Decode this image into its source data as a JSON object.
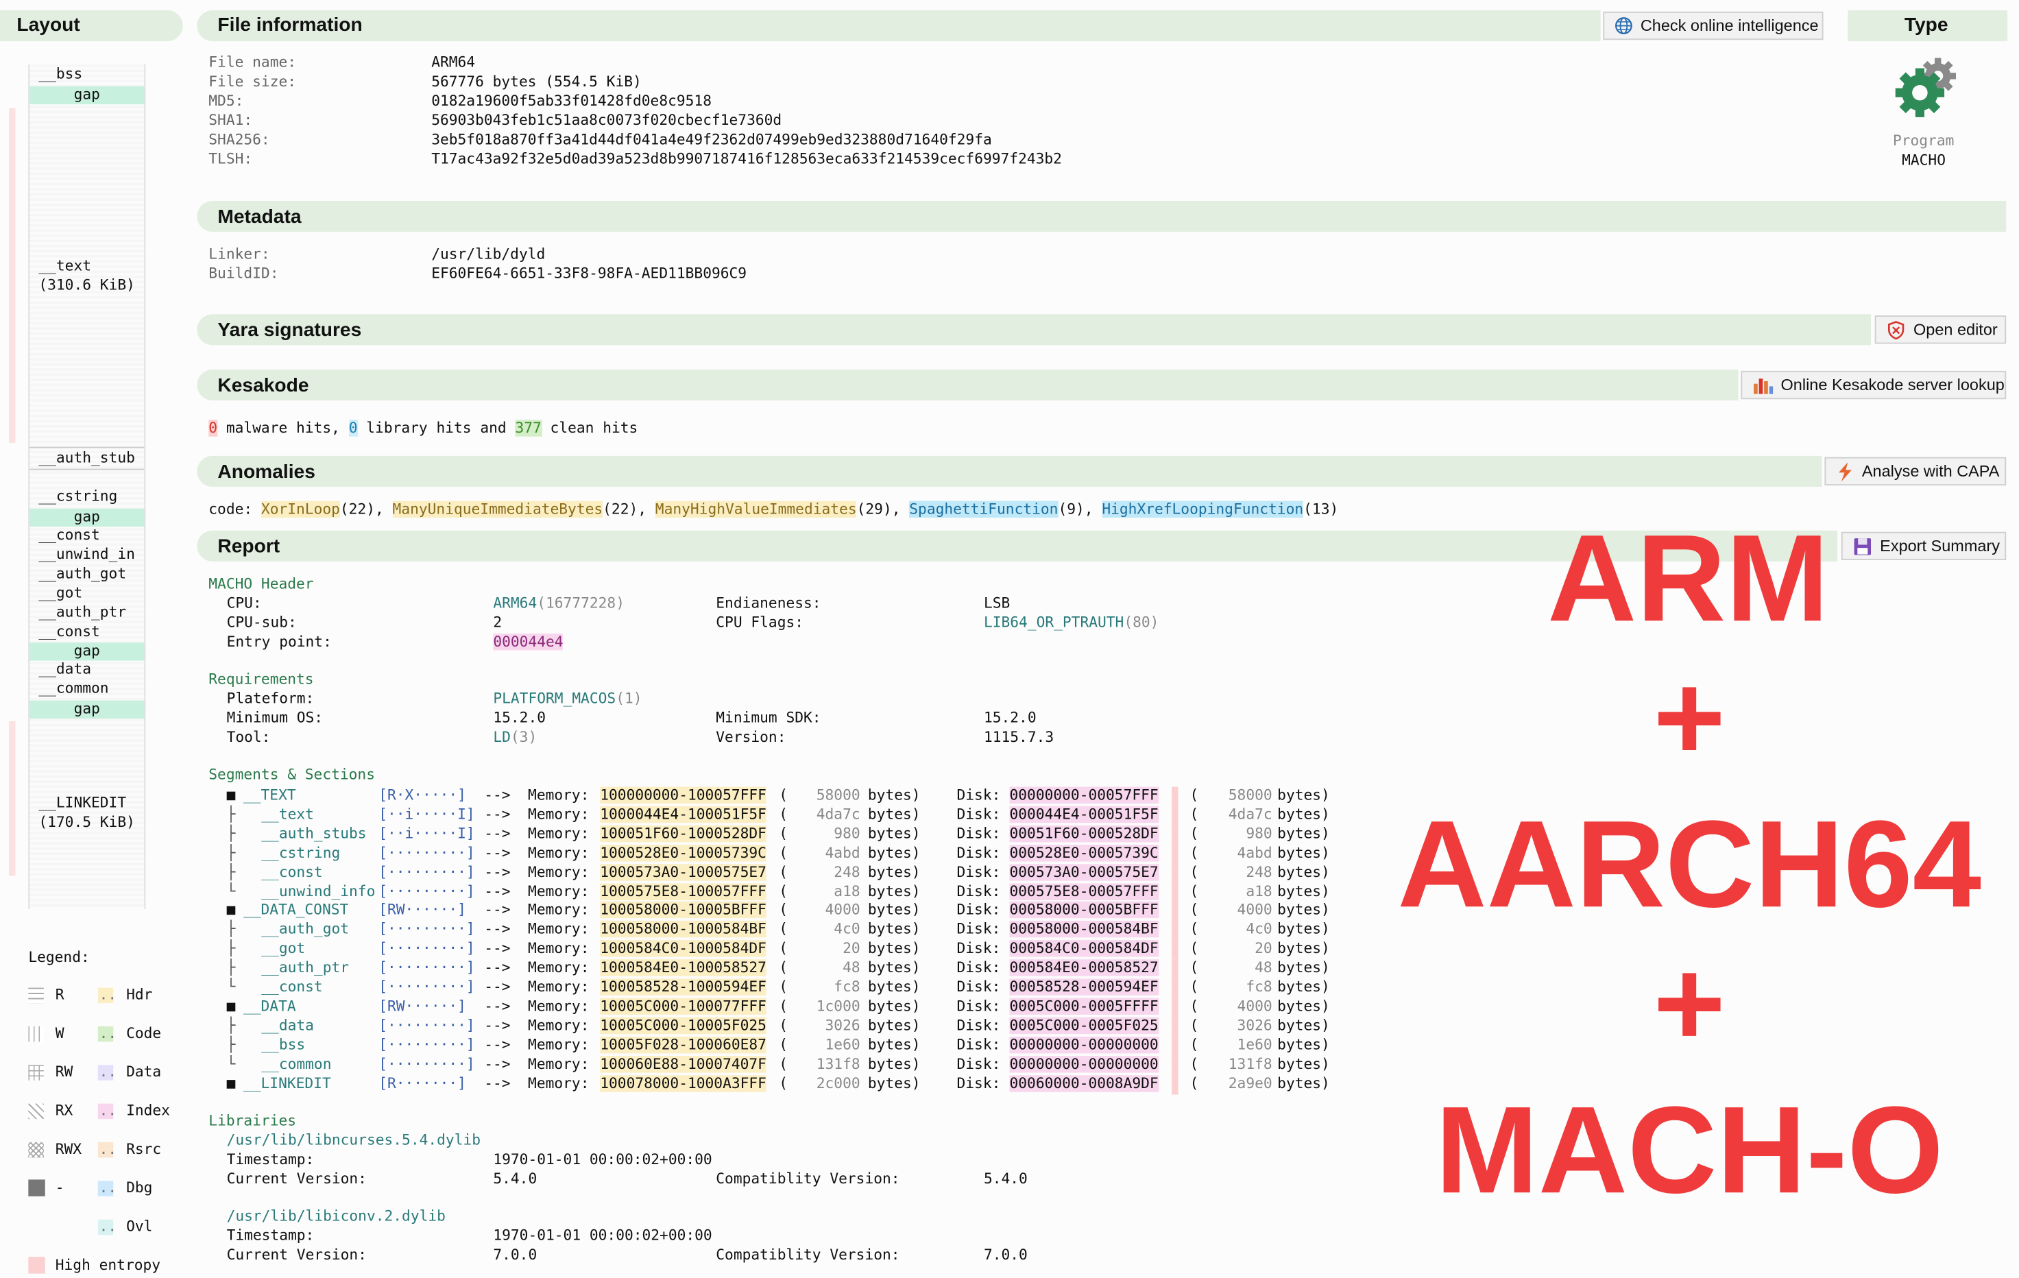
{
  "layout": {
    "title": "Layout",
    "items": [
      {
        "label": "__bss"
      },
      {
        "label": "gap"
      },
      {
        "label": "__text"
      },
      {
        "label": "(310.6 KiB)"
      },
      {
        "label": "__auth_stub"
      },
      {
        "label": "__cstring"
      },
      {
        "label": "gap"
      },
      {
        "label": "__const"
      },
      {
        "label": "__unwind_in"
      },
      {
        "label": "__auth_got"
      },
      {
        "label": "__got"
      },
      {
        "label": "__auth_ptr"
      },
      {
        "label": "__const"
      },
      {
        "label": "gap"
      },
      {
        "label": "__data"
      },
      {
        "label": "__common"
      },
      {
        "label": "gap"
      },
      {
        "label": "__LINKEDIT"
      },
      {
        "label": "(170.5 KiB)"
      }
    ],
    "legend_title": "Legend:",
    "legend": [
      {
        "label": "R"
      },
      {
        "label": "Hdr"
      },
      {
        "label": "W"
      },
      {
        "label": "Code"
      },
      {
        "label": "RW"
      },
      {
        "label": "Data"
      },
      {
        "label": "RX"
      },
      {
        "label": "Index"
      },
      {
        "label": "RWX"
      },
      {
        "label": "Rsrc"
      },
      {
        "label": "-"
      },
      {
        "label": "Dbg"
      },
      {
        "label": "Ovl"
      },
      {
        "label": "High entropy"
      }
    ],
    "legend_dots": ".."
  },
  "file_info": {
    "title": "File information",
    "button": "Check online intelligence",
    "rows": [
      {
        "label": "File name:",
        "value": "ARM64"
      },
      {
        "label": "File size:",
        "value": "567776 bytes (554.5 KiB)"
      },
      {
        "label": "MD5:",
        "value": "0182a19600f5ab33f01428fd0e8c9518"
      },
      {
        "label": "SHA1:",
        "value": "56903b043feb1c51aa8c0073f020cbecf1e7360d"
      },
      {
        "label": "SHA256:",
        "value": "3eb5f018a870ff3a41d44df041a4e49f2362d07499eb9ed323880d71640f29fa"
      },
      {
        "label": "TLSH:",
        "value": "T17ac43a92f32e5d0ad39a523d8b9907187416f128563eca633f214539cecf6997f243b2"
      }
    ]
  },
  "type_panel": {
    "title": "Type",
    "kind": "Program",
    "format": "MACHO",
    "icon": "gear-icon",
    "icon_color": "#2e8b57"
  },
  "metadata": {
    "title": "Metadata",
    "rows": [
      {
        "label": "Linker:",
        "value": "/usr/lib/dyld"
      },
      {
        "label": "BuildID:",
        "value": "EF60FE64-6651-33F8-98FA-AED11BB096C9"
      }
    ]
  },
  "yara": {
    "title": "Yara signatures",
    "button": "Open editor"
  },
  "kesakode": {
    "title": "Kesakode",
    "button": "Online Kesakode server lookup",
    "malware": "0",
    "t1": " malware hits, ",
    "library": "0",
    "t2": " library hits and ",
    "clean": "377",
    "t3": " clean hits"
  },
  "anomalies": {
    "title": "Anomalies",
    "button": "Analyse with CAPA",
    "prefix": "code: ",
    "items": [
      {
        "name": "XorInLoop",
        "count": "(22), "
      },
      {
        "name": "ManyUniqueImmediateBytes",
        "count": "(22), "
      },
      {
        "name": "ManyHighValueImmediates",
        "count": "(29), "
      },
      {
        "name": "SpaghettiFunction",
        "count": "(9), "
      },
      {
        "name": "HighXrefLoopingFunction",
        "count": "(13)"
      }
    ]
  },
  "report": {
    "title": "Report",
    "button": "Export Summary",
    "macho_header": {
      "title": "MACHO Header",
      "cpu_label": "CPU:",
      "cpu_value": "ARM64",
      "cpu_num": "(16777228)",
      "cpusub_label": "CPU-sub:",
      "cpusub_value": "2",
      "entry_label": "Entry point:",
      "entry_value": "000044e4",
      "endian_label": "Endianeness:",
      "endian_value": "LSB",
      "flags_label": "CPU Flags:",
      "flags_value": "LIB64_OR_PTRAUTH",
      "flags_num": "(80)"
    },
    "requirements": {
      "title": "Requirements",
      "platform_label": "Plateform:",
      "platform_value": "PLATFORM_MACOS",
      "platform_num": "(1)",
      "minos_label": "Minimum OS:",
      "minos_value": "15.2.0",
      "minsdk_label": "Minimum SDK:",
      "minsdk_value": "15.2.0",
      "tool_label": "Tool:",
      "tool_value": "LD",
      "tool_num": "(3)",
      "version_label": "Version:",
      "version_value": "1115.7.3"
    },
    "segments": {
      "title": "Segments & Sections",
      "arrow": "-->",
      "mem_label": "Memory:",
      "disk_label": "Disk:",
      "bytes_word": "bytes)",
      "rows": [
        {
          "tree": "■",
          "name": "__TEXT",
          "flags": "[R·X·····]",
          "mem": "100000000-100057FFF",
          "msize": "58000",
          "disk": "00000000-00057FFF",
          "dsize": "58000",
          "seg": true
        },
        {
          "tree": "├",
          "name": "__text",
          "flags": "[··i·····I]",
          "mem": "1000044E4-100051F5F",
          "msize": "4da7c",
          "disk": "000044E4-00051F5F",
          "dsize": "4da7c",
          "seg": false
        },
        {
          "tree": "├",
          "name": "__auth_stubs",
          "flags": "[··i·····I]",
          "mem": "100051F60-1000528DF",
          "msize": "980",
          "disk": "00051F60-000528DF",
          "dsize": "980",
          "seg": false
        },
        {
          "tree": "├",
          "name": "__cstring",
          "flags": "[·········]",
          "mem": "1000528E0-10005739C",
          "msize": "4abd",
          "disk": "000528E0-0005739C",
          "dsize": "4abd",
          "seg": false
        },
        {
          "tree": "├",
          "name": "__const",
          "flags": "[·········]",
          "mem": "1000573A0-1000575E7",
          "msize": "248",
          "disk": "000573A0-000575E7",
          "dsize": "248",
          "seg": false
        },
        {
          "tree": "└",
          "name": "__unwind_info",
          "flags": "[·········]",
          "mem": "1000575E8-100057FFF",
          "msize": "a18",
          "disk": "000575E8-00057FFF",
          "dsize": "a18",
          "seg": false
        },
        {
          "tree": "■",
          "name": "__DATA_CONST",
          "flags": "[RW······]",
          "mem": "100058000-10005BFFF",
          "msize": "4000",
          "disk": "00058000-0005BFFF",
          "dsize": "4000",
          "seg": true
        },
        {
          "tree": "├",
          "name": "__auth_got",
          "flags": "[·········]",
          "mem": "100058000-1000584BF",
          "msize": "4c0",
          "disk": "00058000-000584BF",
          "dsize": "4c0",
          "seg": false
        },
        {
          "tree": "├",
          "name": "__got",
          "flags": "[·········]",
          "mem": "1000584C0-1000584DF",
          "msize": "20",
          "disk": "000584C0-000584DF",
          "dsize": "20",
          "seg": false
        },
        {
          "tree": "├",
          "name": "__auth_ptr",
          "flags": "[·········]",
          "mem": "1000584E0-100058527",
          "msize": "48",
          "disk": "000584E0-00058527",
          "dsize": "48",
          "seg": false
        },
        {
          "tree": "└",
          "name": "__const",
          "flags": "[·········]",
          "mem": "100058528-1000594EF",
          "msize": "fc8",
          "disk": "00058528-000594EF",
          "dsize": "fc8",
          "seg": false
        },
        {
          "tree": "■",
          "name": "__DATA",
          "flags": "[RW······]",
          "mem": "10005C000-100077FFF",
          "msize": "1c000",
          "disk": "0005C000-0005FFFF",
          "dsize": "4000",
          "seg": true
        },
        {
          "tree": "├",
          "name": "__data",
          "flags": "[·········]",
          "mem": "10005C000-10005F025",
          "msize": "3026",
          "disk": "0005C000-0005F025",
          "dsize": "3026",
          "seg": false
        },
        {
          "tree": "├",
          "name": "__bss",
          "flags": "[·········]",
          "mem": "10005F028-100060E87",
          "msize": "1e60",
          "disk": "00000000-00000000",
          "dsize": "1e60",
          "seg": false
        },
        {
          "tree": "└",
          "name": "__common",
          "flags": "[·········]",
          "mem": "100060E88-10007407F",
          "msize": "131f8",
          "disk": "00000000-00000000",
          "dsize": "131f8",
          "seg": false
        },
        {
          "tree": "■",
          "name": "__LINKEDIT",
          "flags": "[R·······]",
          "mem": "100078000-1000A3FFF",
          "msize": "2c000",
          "disk": "00060000-0008A9DF",
          "dsize": "2a9e0",
          "seg": true
        }
      ]
    },
    "libraries": {
      "title": "Librairies",
      "items": [
        {
          "path": "/usr/lib/libncurses.5.4.dylib",
          "ts_label": "Timestamp:",
          "ts": "1970-01-01 00:00:02+00:00",
          "cv_label": "Current Version:",
          "cv": "5.4.0",
          "compat_label": "Compatiblity Version:",
          "compat": "5.4.0"
        },
        {
          "path": "/usr/lib/libiconv.2.dylib",
          "ts_label": "Timestamp:",
          "ts": "1970-01-01 00:00:02+00:00",
          "cv_label": "Current Version:",
          "cv": "7.0.0",
          "compat_label": "Compatiblity Version:",
          "compat": "7.0.0"
        }
      ]
    }
  },
  "overlay": {
    "line1": "ARM",
    "plus": "+",
    "line2": "AARCH64",
    "line3": "MACH-O",
    "color": "#ef3b3b"
  }
}
